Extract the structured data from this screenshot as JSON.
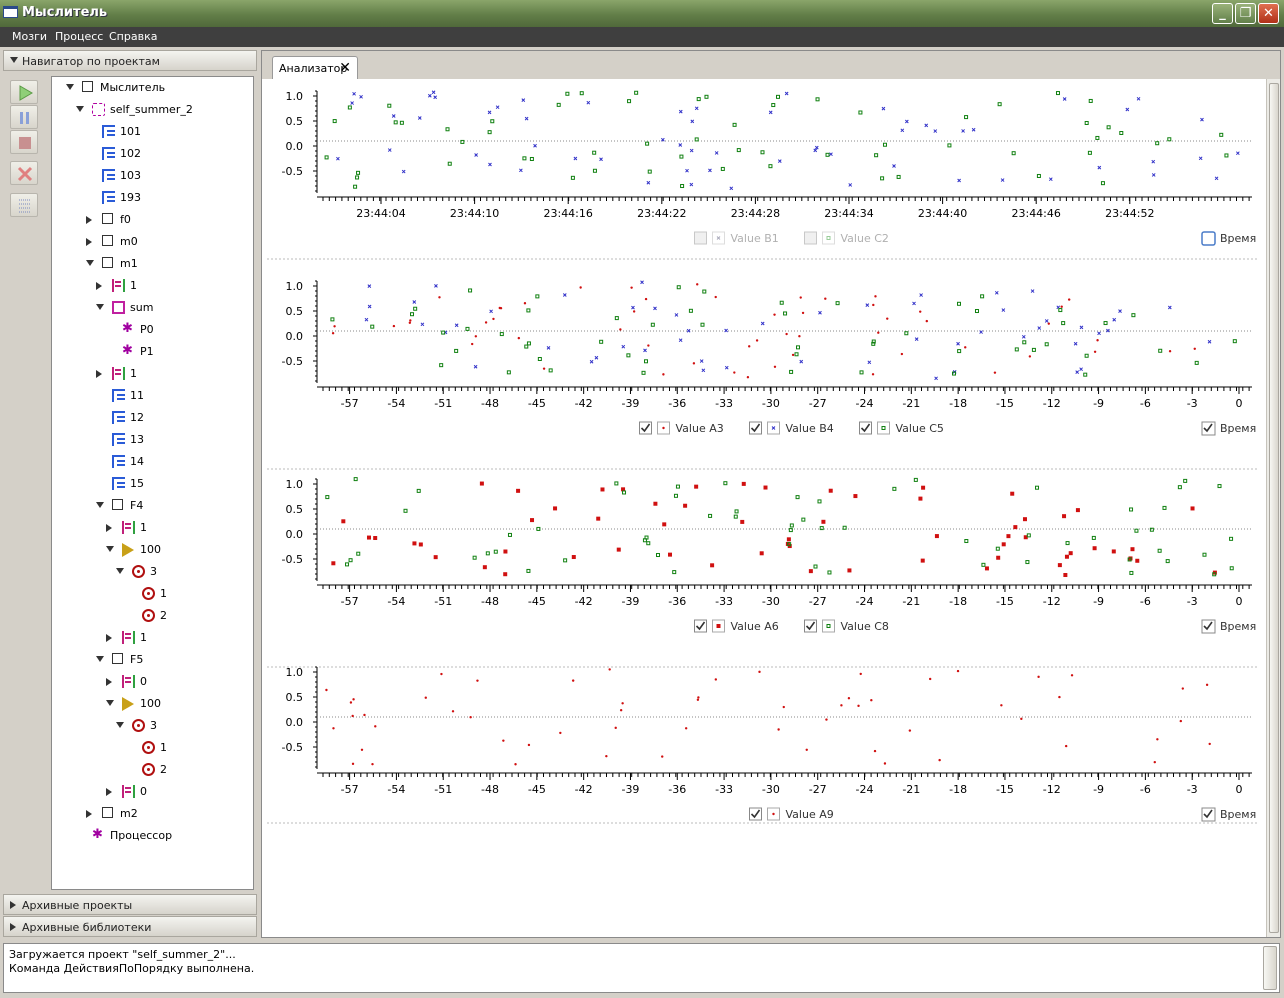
{
  "window": {
    "title": "Мыслитель"
  },
  "menu": [
    "Мозги",
    "Процесс",
    "Справка"
  ],
  "navigator": {
    "title": "Навигатор по проектам",
    "tree": [
      {
        "label": "Мыслитель",
        "icon": "box-icon",
        "level": 0,
        "toggle": "down"
      },
      {
        "label": "self_summer_2",
        "icon": "group-icon",
        "level": 1,
        "toggle": "down"
      },
      {
        "label": "101",
        "icon": "tree-icon",
        "level": 2,
        "toggle": ""
      },
      {
        "label": "102",
        "icon": "tree-icon",
        "level": 2,
        "toggle": ""
      },
      {
        "label": "103",
        "icon": "tree-icon",
        "level": 2,
        "toggle": ""
      },
      {
        "label": "193",
        "icon": "tree-icon",
        "level": 2,
        "toggle": ""
      },
      {
        "label": "f0",
        "icon": "box-icon",
        "level": 2,
        "toggle": "right"
      },
      {
        "label": "m0",
        "icon": "box-icon",
        "level": 2,
        "toggle": "right"
      },
      {
        "label": "m1",
        "icon": "box-icon",
        "level": 2,
        "toggle": "down"
      },
      {
        "label": "1",
        "icon": "ladder-icon",
        "level": 3,
        "toggle": "right"
      },
      {
        "label": "sum",
        "icon": "grid-icon",
        "level": 3,
        "toggle": "down"
      },
      {
        "label": "P0",
        "icon": "star-icon",
        "level": 4,
        "toggle": ""
      },
      {
        "label": "P1",
        "icon": "star-icon",
        "level": 4,
        "toggle": ""
      },
      {
        "label": "1",
        "icon": "ladder-icon",
        "level": 3,
        "toggle": "right"
      },
      {
        "label": "11",
        "icon": "tree-icon",
        "level": 3,
        "toggle": ""
      },
      {
        "label": "12",
        "icon": "tree-icon",
        "level": 3,
        "toggle": ""
      },
      {
        "label": "13",
        "icon": "tree-icon",
        "level": 3,
        "toggle": ""
      },
      {
        "label": "14",
        "icon": "tree-icon",
        "level": 3,
        "toggle": ""
      },
      {
        "label": "15",
        "icon": "tree-icon",
        "level": 3,
        "toggle": ""
      },
      {
        "label": "F4",
        "icon": "box-icon",
        "level": 3,
        "toggle": "down"
      },
      {
        "label": "1",
        "icon": "ladder-icon",
        "level": 4,
        "toggle": "right"
      },
      {
        "label": "100",
        "icon": "triangle-icon",
        "level": 4,
        "toggle": "down"
      },
      {
        "label": "3",
        "icon": "target-icon",
        "level": 5,
        "toggle": "down"
      },
      {
        "label": "1",
        "icon": "target-icon",
        "level": 6,
        "toggle": ""
      },
      {
        "label": "2",
        "icon": "target-icon",
        "level": 6,
        "toggle": ""
      },
      {
        "label": "1",
        "icon": "ladder-icon",
        "level": 4,
        "toggle": "right"
      },
      {
        "label": "F5",
        "icon": "box-icon",
        "level": 3,
        "toggle": "down"
      },
      {
        "label": "0",
        "icon": "ladder-icon",
        "level": 4,
        "toggle": "right"
      },
      {
        "label": "100",
        "icon": "triangle-icon",
        "level": 4,
        "toggle": "down"
      },
      {
        "label": "3",
        "icon": "target-icon",
        "level": 5,
        "toggle": "down"
      },
      {
        "label": "1",
        "icon": "target-icon",
        "level": 6,
        "toggle": ""
      },
      {
        "label": "2",
        "icon": "target-icon",
        "level": 6,
        "toggle": ""
      },
      {
        "label": "0",
        "icon": "ladder-icon",
        "level": 4,
        "toggle": "right"
      },
      {
        "label": "m2",
        "icon": "box-icon",
        "level": 2,
        "toggle": "right"
      },
      {
        "label": "Процессор",
        "icon": "star-icon",
        "level": 1,
        "toggle": ""
      }
    ]
  },
  "sections": {
    "archive_projects": "Архивные проекты",
    "archive_libraries": "Архивные библиотеки"
  },
  "tab": {
    "label": "Анализатор",
    "close": "✕"
  },
  "colors": {
    "A3": "#d01010",
    "B4": "#3030c8",
    "C5": "#108010",
    "A6": "#d01010",
    "C8": "#108010",
    "A9": "#d01010",
    "B1": "#3030c8",
    "C2": "#108010"
  },
  "chart_data": [
    {
      "type": "scatter",
      "yticks": [
        "1.0",
        "0.5",
        "0.0",
        "-0.5"
      ],
      "xticks": [
        "23:44:04",
        "23:44:10",
        "23:44:16",
        "23:44:22",
        "23:44:28",
        "23:44:34",
        "23:44:40",
        "23:44:46",
        "23:44:52"
      ],
      "ylim": [
        -0.9,
        1.1
      ],
      "reference_line": 0.1,
      "series": [
        {
          "name": "Value B1",
          "checked": false,
          "enabled": false,
          "marker": "x",
          "color": "#3030c8"
        },
        {
          "name": "Value C2",
          "checked": false,
          "enabled": false,
          "marker": "square",
          "color": "#108010"
        }
      ],
      "time_checkbox": {
        "label": "Время",
        "checked": false
      }
    },
    {
      "type": "scatter",
      "yticks": [
        "1.0",
        "0.5",
        "0.0",
        "-0.5"
      ],
      "xticks": [
        "-57",
        "-54",
        "-51",
        "-48",
        "-45",
        "-42",
        "-39",
        "-36",
        "-33",
        "-30",
        "-27",
        "-24",
        "-21",
        "-18",
        "-15",
        "-12",
        "-9",
        "-6",
        "-3",
        "0"
      ],
      "xlim": [
        -58,
        0
      ],
      "ylim": [
        -0.9,
        1.1
      ],
      "reference_line": 0.1,
      "series": [
        {
          "name": "Value A3",
          "checked": true,
          "enabled": true,
          "marker": "dot",
          "color": "#d01010"
        },
        {
          "name": "Value B4",
          "checked": true,
          "enabled": true,
          "marker": "x",
          "color": "#3030c8"
        },
        {
          "name": "Value C5",
          "checked": true,
          "enabled": true,
          "marker": "square",
          "color": "#108010"
        }
      ],
      "time_checkbox": {
        "label": "Время",
        "checked": true
      }
    },
    {
      "type": "scatter",
      "yticks": [
        "1.0",
        "0.5",
        "0.0",
        "-0.5"
      ],
      "xticks": [
        "-57",
        "-54",
        "-51",
        "-48",
        "-45",
        "-42",
        "-39",
        "-36",
        "-33",
        "-30",
        "-27",
        "-24",
        "-21",
        "-18",
        "-15",
        "-12",
        "-9",
        "-6",
        "-3",
        "0"
      ],
      "xlim": [
        -58,
        0
      ],
      "ylim": [
        -0.9,
        1.1
      ],
      "reference_line": 0.1,
      "series": [
        {
          "name": "Value A6",
          "checked": true,
          "enabled": true,
          "marker": "square",
          "color": "#d01010"
        },
        {
          "name": "Value C8",
          "checked": true,
          "enabled": true,
          "marker": "square",
          "color": "#108010"
        }
      ],
      "time_checkbox": {
        "label": "Время",
        "checked": true
      }
    },
    {
      "type": "scatter",
      "yticks": [
        "1.0",
        "0.5",
        "0.0",
        "-0.5"
      ],
      "xticks": [
        "-57",
        "-54",
        "-51",
        "-48",
        "-45",
        "-42",
        "-39",
        "-36",
        "-33",
        "-30",
        "-27",
        "-24",
        "-21",
        "-18",
        "-15",
        "-12",
        "-9",
        "-6",
        "-3",
        "0"
      ],
      "xlim": [
        -58,
        0
      ],
      "ylim": [
        -0.9,
        1.1
      ],
      "reference_line": 0.1,
      "series": [
        {
          "name": "Value A9",
          "checked": true,
          "enabled": true,
          "marker": "dot",
          "color": "#d01010"
        }
      ],
      "time_checkbox": {
        "label": "Время",
        "checked": true
      }
    }
  ],
  "console": {
    "lines": [
      "Загружается проект \"self_summer_2\"...",
      "Команда ДействияПоПорядку выполнена."
    ]
  }
}
